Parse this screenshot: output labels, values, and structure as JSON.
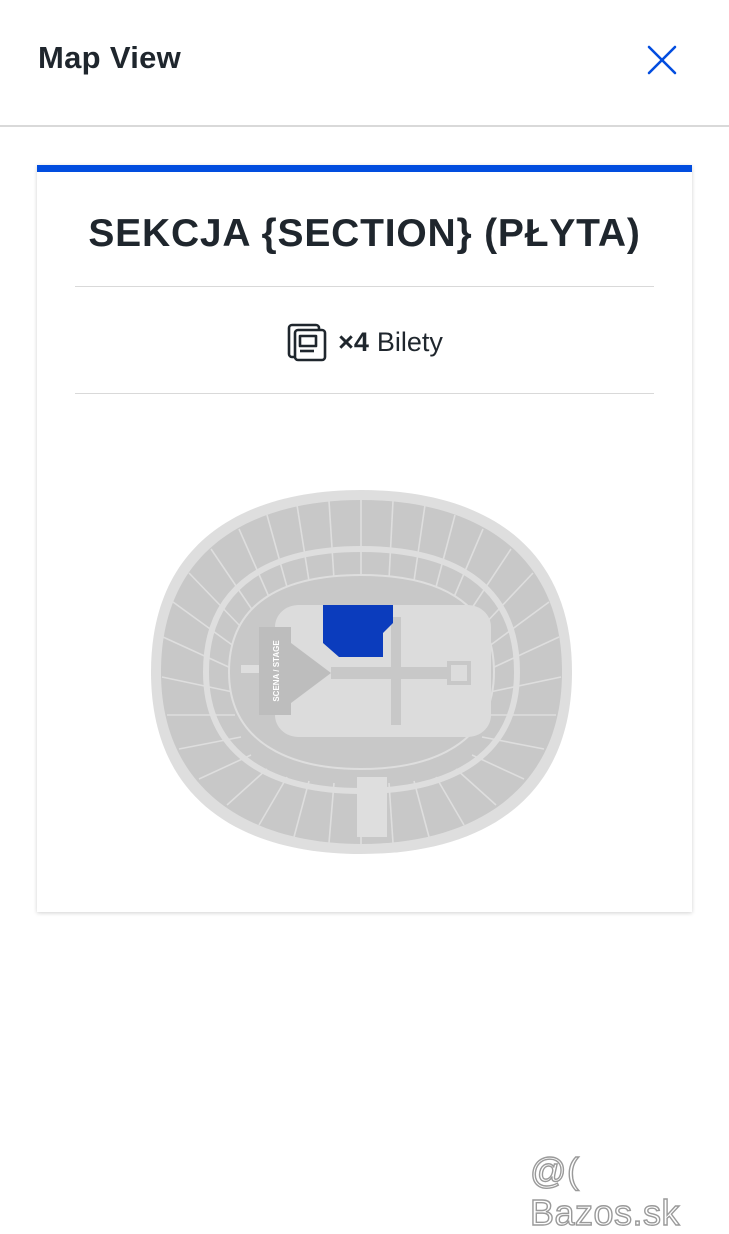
{
  "header": {
    "title": "Map View",
    "close_icon": "close-icon"
  },
  "card": {
    "accent_color": "#024ddf",
    "section_title": "SEKCJA {SECTION} (PŁYTA)",
    "tickets": {
      "icon": "ticket-icon",
      "count": "×4",
      "label": "Bilety"
    }
  },
  "map": {
    "stage_label": "SCENA / STAGE",
    "highlight_color": "#0b3cbd",
    "section_color": "#c9c9c9",
    "floor_color": "#dcdcdc"
  },
  "watermark": "@( Bazos.sk"
}
